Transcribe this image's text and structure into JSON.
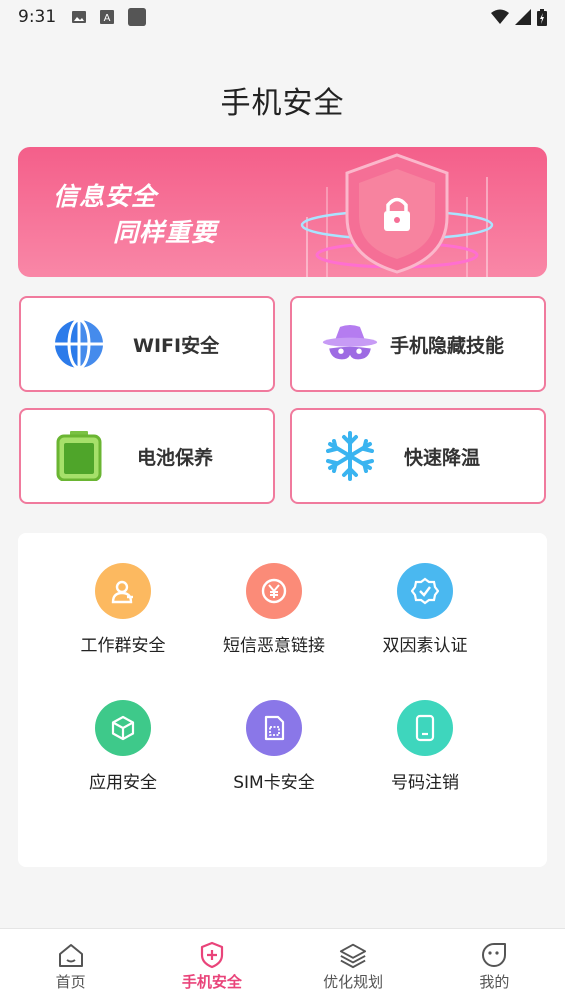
{
  "status_bar": {
    "time": "9:31"
  },
  "page": {
    "title": "手机安全"
  },
  "banner": {
    "line1": "信息安全",
    "line2": "同样重要"
  },
  "feature_cards": [
    {
      "label": "WIFI安全",
      "icon": "globe-icon"
    },
    {
      "label": "手机隐藏技能",
      "icon": "incognito-icon"
    },
    {
      "label": "电池保养",
      "icon": "battery-icon"
    },
    {
      "label": "快速降温",
      "icon": "snowflake-icon"
    }
  ],
  "grid": {
    "items": [
      {
        "label": "工作群安全",
        "icon": "user-icon",
        "color": "#fcb960"
      },
      {
        "label": "短信恶意链接",
        "icon": "yen-icon",
        "color": "#fb8b78"
      },
      {
        "label": "双因素认证",
        "icon": "badge-check-icon",
        "color": "#4ab8f0"
      },
      {
        "label": "应用安全",
        "icon": "cube-icon",
        "color": "#3ec98a"
      },
      {
        "label": "SIM卡安全",
        "icon": "sim-card-icon",
        "color": "#8a77e8"
      },
      {
        "label": "号码注销",
        "icon": "phone-icon",
        "color": "#3ed6bd"
      }
    ]
  },
  "bottom_nav": {
    "items": [
      {
        "label": "首页",
        "icon": "home-icon"
      },
      {
        "label": "手机安全",
        "icon": "shield-plus-icon",
        "active": true
      },
      {
        "label": "优化规划",
        "icon": "layers-icon"
      },
      {
        "label": "我的",
        "icon": "face-icon"
      }
    ]
  },
  "colors": {
    "accent": "#e9447a",
    "card_border": "#f07a9d"
  }
}
